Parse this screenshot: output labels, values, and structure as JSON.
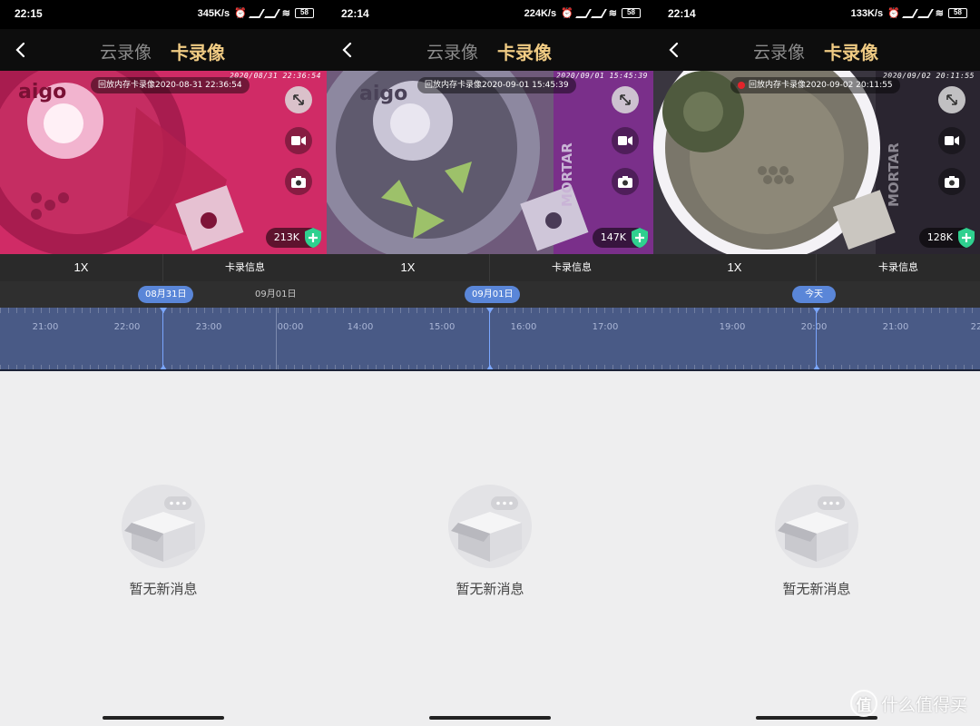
{
  "phones": [
    {
      "status": {
        "time": "22:15",
        "net_speed": "345K/s",
        "battery": "58"
      },
      "nav": {
        "tab_cloud": "云录像",
        "tab_card": "卡录像"
      },
      "video": {
        "osd_timestamp": "2020/08/31  22:36:54",
        "playback_label": "回放内存卡录像2020-08-31 22:36:54",
        "recording_dot": false,
        "speed": "213K",
        "scene_color": "#d42f6d"
      },
      "controls": {
        "speed": "1X",
        "info": "卡录信息"
      },
      "date_bar": {
        "active": "08月31日",
        "next": "09月01日"
      },
      "timeline_labels": [
        "21:00",
        "22:00",
        "23:00",
        "00:00"
      ],
      "empty_text": "暂无新消息"
    },
    {
      "status": {
        "time": "22:14",
        "net_speed": "224K/s",
        "battery": "58"
      },
      "nav": {
        "tab_cloud": "云录像",
        "tab_card": "卡录像"
      },
      "video": {
        "osd_timestamp": "2020/09/01  15:45:39",
        "playback_label": "回放内存卡录像2020-09-01 15:45:39",
        "recording_dot": false,
        "speed": "147K",
        "scene_color": "#8d6fa0"
      },
      "controls": {
        "speed": "1X",
        "info": "卡录信息"
      },
      "date_bar": {
        "active": "09月01日"
      },
      "timeline_labels": [
        "14:00",
        "15:00",
        "16:00",
        "17:00"
      ],
      "empty_text": "暂无新消息"
    },
    {
      "status": {
        "time": "22:14",
        "net_speed": "133K/s",
        "battery": "58"
      },
      "nav": {
        "tab_cloud": "云录像",
        "tab_card": "卡录像"
      },
      "video": {
        "osd_timestamp": "2020/09/02  20:11:55",
        "playback_label": "回放内存卡录像2020-09-02 20:11:55",
        "recording_dot": true,
        "speed": "128K",
        "scene_color": "#6f6c63"
      },
      "controls": {
        "speed": "1X",
        "info": "卡录信息"
      },
      "date_bar": {
        "active": "今天"
      },
      "timeline_labels": [
        "19:00",
        "20:00",
        "21:00",
        "22"
      ],
      "empty_text": "暂无新消息"
    }
  ],
  "watermark": {
    "logo": "值",
    "text": "什么值得买"
  }
}
